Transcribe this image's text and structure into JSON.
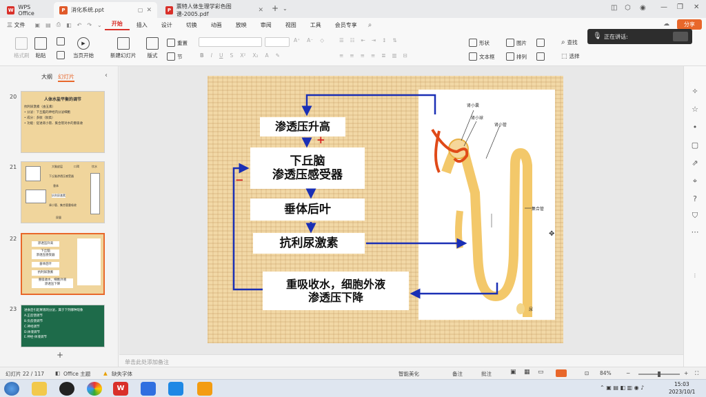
{
  "titlebar": {
    "home_tab": "WPS Office",
    "tab1": "消化系统.ppt",
    "tab2": "票特人体生理学彩色图谱-2005.pdf",
    "new_tab": "+"
  },
  "menu": {
    "file": "三 文件",
    "items": [
      "开始",
      "插入",
      "设计",
      "切换",
      "动画",
      "放映",
      "审阅",
      "视图",
      "工具",
      "会员专享"
    ],
    "share": "分享"
  },
  "toolbar": {
    "format_painter": "格式刷",
    "paste": "粘贴",
    "play_current": "当页开始",
    "new_slide": "新建幻灯片",
    "layout": "版式",
    "reset": "重置",
    "section": "节",
    "shape": "形状",
    "picture": "图片",
    "textbox": "文本框",
    "arrange": "排列",
    "find": "查找",
    "select": "选择"
  },
  "popup": {
    "text": "正在讲话:"
  },
  "leftpanel": {
    "tab_outline": "大纲",
    "tab_slides": "幻灯片",
    "slides": [
      {
        "num": "20",
        "title": "人体水盐平衡的调节",
        "lines": [
          "抗利尿激素（由五素）",
          "• 分泌：下丘脑的神经内分泌细胞",
          "• 成分：多肽（肽类）",
          "• 功能：促进肾小管、集合管对水的重吸收"
        ]
      },
      {
        "num": "21",
        "labels": [
          "大脑皮层",
          "口渴",
          "饮水",
          "下丘脑渗透压感受器",
          "垂体",
          "抗利尿激素",
          "肾小管、集合管重吸收",
          "尿量"
        ]
      },
      {
        "num": "22"
      },
      {
        "num": "23",
        "lines": [
          "进食后引起胃液的分泌，属于下列哪种现象",
          "A.正反馈调节",
          "B.负反馈调节",
          "C.神经调节",
          "D.体液调节",
          "E.神经-体液调节"
        ]
      }
    ]
  },
  "slide": {
    "box1": "渗透压升高",
    "box2_line1": "下丘脑",
    "box2_line2": "渗透压感受器",
    "box3": "垂体后叶",
    "box4": "抗利尿激素",
    "box5_line1": "重吸收水，细胞外液",
    "box5_line2": "渗透压下降",
    "plus": "+",
    "minus": "−",
    "diagram_labels": {
      "renal_capsule": "肾小囊",
      "glomerulus": "肾小球",
      "tubule": "肾小管",
      "collecting_duct": "集合管",
      "urine": "尿"
    }
  },
  "notes": {
    "placeholder": "单击此处添加备注"
  },
  "status": {
    "slide_count": "幻灯片 22 / 117",
    "theme": "Office 主题",
    "missing_font": "缺失字体",
    "smart_beautify": "智能美化",
    "notes": "备注",
    "comments": "批注",
    "zoom": "84%"
  },
  "taskbar": {
    "time": "15:03",
    "date": "2023/10/1"
  },
  "colors": {
    "accent": "#d9302a",
    "arrow_blue": "#1a2fb5",
    "plus_red": "#d42020"
  }
}
